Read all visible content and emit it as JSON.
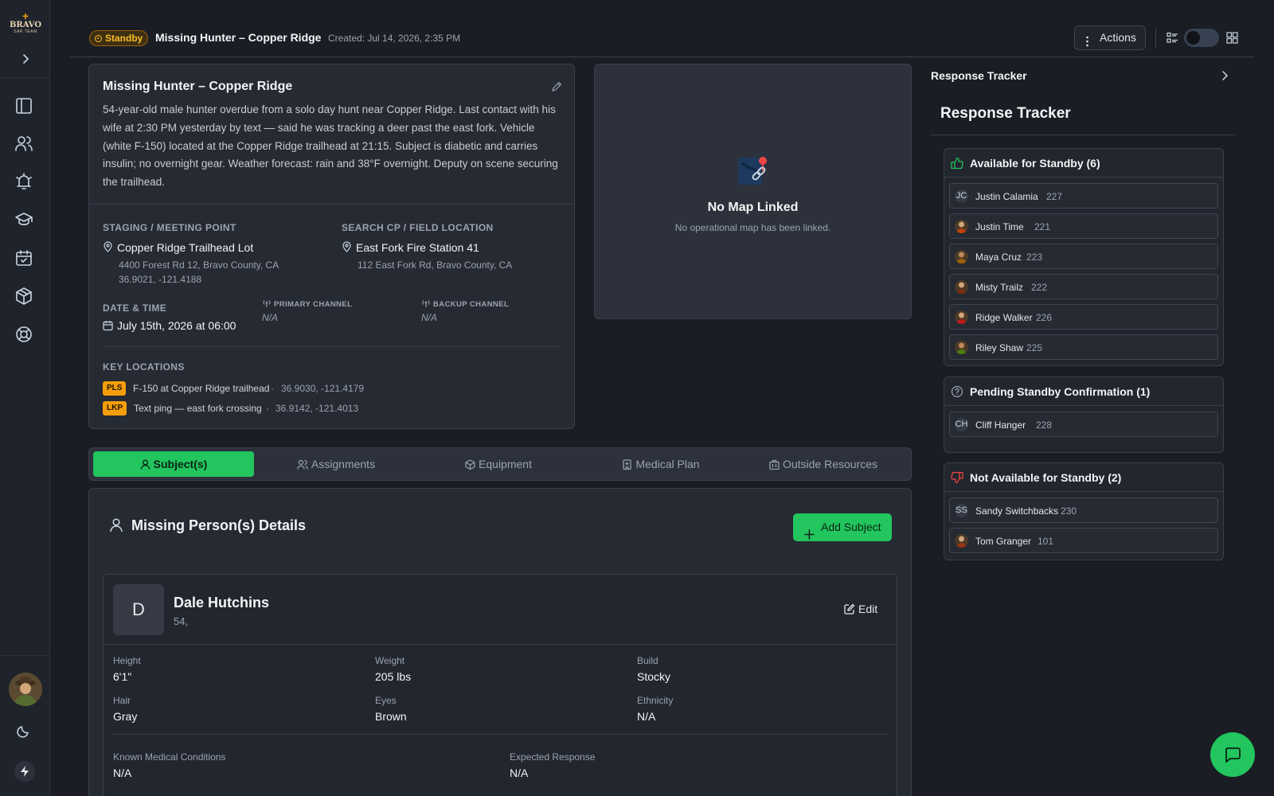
{
  "app": {
    "logo_line1": "BRAVO",
    "logo_line2": "SAR TEAM",
    "nav": [
      "sidebar-toggle-icon",
      "users-icon",
      "alarm-icon",
      "training-icon",
      "calendar-check-icon",
      "package-icon",
      "lifebuoy-icon"
    ]
  },
  "header": {
    "status": "Standby",
    "title": "Missing Hunter – Copper Ridge",
    "created": "Created: Jul 14, 2026, 2:35 PM",
    "actions_label": "Actions"
  },
  "incident": {
    "title": "Missing Hunter – Copper Ridge",
    "description": "54-year-old male hunter overdue from a solo day hunt near Copper Ridge. Last contact with his wife at 2:30 PM yesterday by text — said he was tracking a deer past the east fork. Vehicle (white F-150) located at the Copper Ridge trailhead at 21:15. Subject is diabetic and carries insulin; no overnight gear. Weather forecast: rain and 38°F overnight. Deputy on scene securing the trailhead.",
    "staging": {
      "label": "STAGING / MEETING POINT",
      "name": "Copper Ridge Trailhead Lot",
      "address": "4400 Forest Rd 12, Bravo County, CA",
      "coords": "36.9021, -121.4188"
    },
    "search_cp": {
      "label": "SEARCH CP / FIELD LOCATION",
      "name": "East Fork Fire Station 41",
      "address": "112 East Fork Rd, Bravo County, CA"
    },
    "datetime": {
      "label": "DATE & TIME",
      "value": "July 15th, 2026 at 06:00"
    },
    "primary_channel": {
      "label": "PRIMARY CHANNEL",
      "value": "N/A"
    },
    "backup_channel": {
      "label": "BACKUP CHANNEL",
      "value": "N/A"
    },
    "key_locations": {
      "label": "KEY LOCATIONS",
      "items": [
        {
          "tag": "PLS",
          "text": "F-150 at Copper Ridge trailhead",
          "coords": "36.9030, -121.4179"
        },
        {
          "tag": "LKP",
          "text": "Text ping — east fork crossing",
          "coords": "36.9142, -121.4013"
        }
      ]
    }
  },
  "map": {
    "title": "No Map Linked",
    "subtitle": "No operational map has been linked."
  },
  "tabs": [
    {
      "label": "Subject(s)",
      "active": true,
      "icon": "user-icon"
    },
    {
      "label": "Assignments",
      "active": false,
      "icon": "users-icon"
    },
    {
      "label": "Equipment",
      "active": false,
      "icon": "package-icon"
    },
    {
      "label": "Medical Plan",
      "active": false,
      "icon": "hospital-icon"
    },
    {
      "label": "Outside Resources",
      "active": false,
      "icon": "building-icon"
    }
  ],
  "subjects": {
    "title": "Missing Person(s) Details",
    "add_label": "Add Subject",
    "subject": {
      "initial": "D",
      "name": "Dale Hutchins",
      "age": "54,",
      "edit_label": "Edit",
      "fields": {
        "height": {
          "label": "Height",
          "value": "6'1\""
        },
        "weight": {
          "label": "Weight",
          "value": "205 lbs"
        },
        "build": {
          "label": "Build",
          "value": "Stocky"
        },
        "hair": {
          "label": "Hair",
          "value": "Gray"
        },
        "eyes": {
          "label": "Eyes",
          "value": "Brown"
        },
        "ethnicity": {
          "label": "Ethnicity",
          "value": "N/A"
        },
        "medical": {
          "label": "Known Medical Conditions",
          "value": "N/A"
        },
        "expected": {
          "label": "Expected Response",
          "value": "N/A"
        }
      }
    }
  },
  "tracker": {
    "header": "Response Tracker",
    "title": "Response Tracker",
    "groups": {
      "available": {
        "title": "Available for Standby (6)",
        "people": [
          {
            "avatar": "JC",
            "name": "Justin Calamia",
            "num": "227"
          },
          {
            "avatar": "",
            "name": "Justin Time",
            "num": "221"
          },
          {
            "avatar": "",
            "name": "Maya Cruz",
            "num": "223"
          },
          {
            "avatar": "",
            "name": "Misty Trailz",
            "num": "222"
          },
          {
            "avatar": "",
            "name": "Ridge Walker",
            "num": "226"
          },
          {
            "avatar": "",
            "name": "Riley Shaw",
            "num": "225"
          }
        ]
      },
      "pending": {
        "title": "Pending Standby Confirmation (1)",
        "people": [
          {
            "avatar": "CH",
            "name": "Cliff Hanger",
            "num": "228"
          }
        ]
      },
      "unavailable": {
        "title": "Not Available for Standby (2)",
        "people": [
          {
            "avatar": "SS",
            "name": "Sandy Switchbacks",
            "num": "230"
          },
          {
            "avatar": "",
            "name": "Tom Granger",
            "num": "101"
          }
        ]
      }
    }
  },
  "colors": {
    "accent_green": "#22c55e",
    "standby_amber": "#fbbf24",
    "tag_amber": "#f59e0b",
    "thumbs_down_red": "#ef4444"
  }
}
